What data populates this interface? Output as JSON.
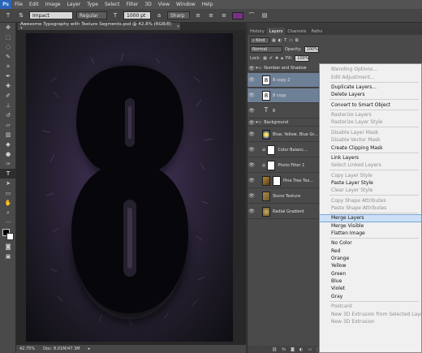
{
  "app": {
    "logo": "Ps",
    "menu": [
      "File",
      "Edit",
      "Image",
      "Layer",
      "Type",
      "Select",
      "Filter",
      "3D",
      "View",
      "Window",
      "Help"
    ]
  },
  "options": {
    "font_family": "Impact",
    "font_style": "Regular",
    "font_size": "1000 pt",
    "antialias": "Sharp",
    "color": "#7a2f86"
  },
  "document": {
    "tab_title": "Awesome Typography with Texture Segments.psd @ 42.8% (RGB/8) *",
    "zoom": "42.75%",
    "doc_info": "Doc: 8.01M/47.3M"
  },
  "panel": {
    "tabs": [
      "History",
      "Layers",
      "Channels",
      "Paths"
    ],
    "active_tab": "Layers",
    "kind": "Kind",
    "blend": "Normal",
    "opacity_label": "Opacity:",
    "opacity": "100%",
    "lock_label": "Lock:",
    "fill_label": "Fill:",
    "fill": "100%"
  },
  "layers": [
    {
      "name": "Number and Shadow",
      "type": "group"
    },
    {
      "name": "8 copy 2",
      "type": "text-thumb",
      "selected": true
    },
    {
      "name": "8 copy",
      "type": "text-thumb",
      "selected": true
    },
    {
      "name": "8",
      "type": "text"
    },
    {
      "name": "Background",
      "type": "group"
    },
    {
      "name": "Blue, Yellow, Blue Gr...",
      "type": "gradient"
    },
    {
      "name": "Color Balanc...",
      "type": "adjust"
    },
    {
      "name": "Photo Filter 1",
      "type": "adjust"
    },
    {
      "name": "Pine Tree Tex...",
      "type": "image"
    },
    {
      "name": "Stone Texture",
      "type": "image"
    },
    {
      "name": "Radial Gradient",
      "type": "gradient"
    }
  ],
  "context_menu": {
    "items": [
      {
        "label": "Blending Options...",
        "disabled": true
      },
      {
        "label": "Edit Adjustment...",
        "disabled": true
      },
      {
        "sep": true
      },
      {
        "label": "Duplicate Layers...",
        "disabled": false
      },
      {
        "label": "Delete Layers",
        "disabled": false
      },
      {
        "sep": true
      },
      {
        "label": "Convert to Smart Object",
        "disabled": false
      },
      {
        "sep": true
      },
      {
        "label": "Rasterize Layers",
        "disabled": true
      },
      {
        "label": "Rasterize Layer Style",
        "disabled": true
      },
      {
        "sep": true
      },
      {
        "label": "Disable Layer Mask",
        "disabled": true
      },
      {
        "label": "Disable Vector Mask",
        "disabled": true
      },
      {
        "label": "Create Clipping Mask",
        "disabled": false
      },
      {
        "sep": true
      },
      {
        "label": "Link Layers",
        "disabled": false
      },
      {
        "label": "Select Linked Layers",
        "disabled": true
      },
      {
        "sep": true
      },
      {
        "label": "Copy Layer Style",
        "disabled": true
      },
      {
        "label": "Paste Layer Style",
        "disabled": false
      },
      {
        "label": "Clear Layer Style",
        "disabled": true
      },
      {
        "sep": true
      },
      {
        "label": "Copy Shape Attributes",
        "disabled": true
      },
      {
        "label": "Paste Shape Attributes",
        "disabled": true
      },
      {
        "sep": true
      },
      {
        "label": "Merge Layers",
        "disabled": false,
        "highlight": true
      },
      {
        "label": "Merge Visible",
        "disabled": false
      },
      {
        "label": "Flatten Image",
        "disabled": false
      },
      {
        "sep": true
      },
      {
        "label": "No Color",
        "disabled": false
      },
      {
        "label": "Red",
        "disabled": false
      },
      {
        "label": "Orange",
        "disabled": false
      },
      {
        "label": "Yellow",
        "disabled": false
      },
      {
        "label": "Green",
        "disabled": false
      },
      {
        "label": "Blue",
        "disabled": false
      },
      {
        "label": "Violet",
        "disabled": false
      },
      {
        "label": "Gray",
        "disabled": false
      },
      {
        "sep": true
      },
      {
        "label": "Postcard",
        "disabled": true
      },
      {
        "label": "New 3D Extrusion from Selected Layer",
        "disabled": true
      },
      {
        "label": "New 3D Extrusion",
        "disabled": true
      }
    ]
  }
}
